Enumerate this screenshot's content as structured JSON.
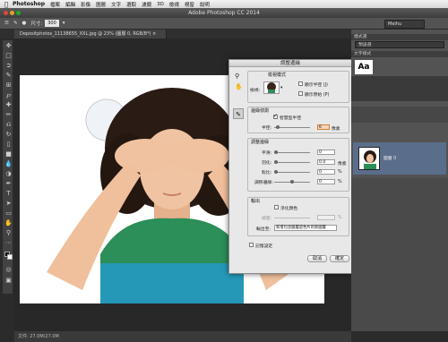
{
  "mac_menu": {
    "app": "Photoshop",
    "items": [
      "檔案",
      "編輯",
      "影像",
      "圖層",
      "文字",
      "選取",
      "濾鏡",
      "3D",
      "檢視",
      "視窗",
      "說明"
    ],
    "right": ""
  },
  "window_title": "Adobe Photoshop CC 2014",
  "options_bar": {
    "size_label": "尺寸:",
    "size_value": "300",
    "workspace": "Meihu"
  },
  "doc_tab": "Depositphotos_11138655_XXL.jpg @ 23% (圖層 0, RGB/8*) ×",
  "status_bar": "文件: 27.0M/27.0M",
  "dialog": {
    "title": "調整邊緣",
    "view_mode_group": "檢視模式",
    "view_label": "檢視:",
    "show_radius": "顯示半徑 (J)",
    "show_original": "顯示原始 (P)",
    "edge_detection_group": "邊緣偵測",
    "smart_radius": "智慧型半徑",
    "radius_label": "半徑:",
    "radius_value": "6",
    "px_unit": "像素",
    "adjust_edge_group": "調整邊緣",
    "smooth_label": "平滑:",
    "smooth_value": "0",
    "feather_label": "羽化:",
    "feather_value": "0.0",
    "feather_unit": "像素",
    "contrast_label": "對比:",
    "contrast_value": "0",
    "pct": "%",
    "shift_label": "調移邊緣:",
    "shift_value": "0",
    "output_group": "輸出",
    "decontam": "淨化顏色",
    "amount_label": "總量:",
    "output_to_label": "輸出至:",
    "output_to_value": "新增包含圖層遮色片的新圖層",
    "remember": "記憶設定",
    "cancel": "取消",
    "ok": "確定"
  },
  "right_panel": {
    "header1": "樣式選",
    "dropdown": "預設選",
    "aa_label": "Aa",
    "header2": "文字樣式",
    "layer_name": "圖層 0"
  },
  "colors": {
    "accent": "#5a6e8c",
    "workspace_bg": "#282828",
    "panel_bg": "#535353",
    "dialog_bg": "#e8e8e8"
  }
}
